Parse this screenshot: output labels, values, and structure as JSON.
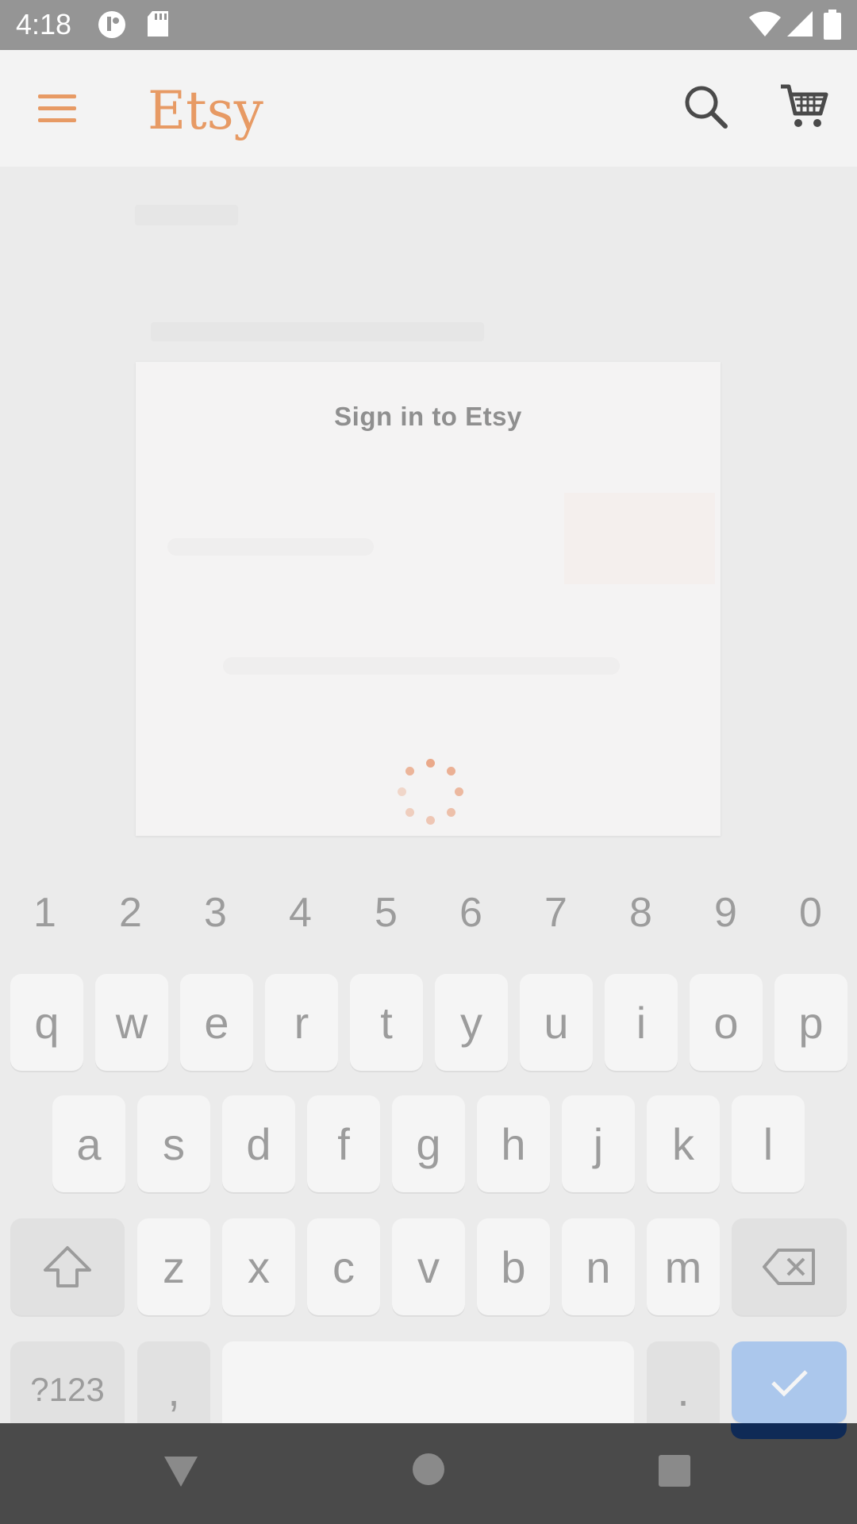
{
  "status_bar": {
    "time": "4:18"
  },
  "app_bar": {
    "logo": "Etsy"
  },
  "dialog": {
    "title": "Sign in to Etsy"
  },
  "keyboard": {
    "numbers": [
      "1",
      "2",
      "3",
      "4",
      "5",
      "6",
      "7",
      "8",
      "9",
      "0"
    ],
    "row1": [
      "q",
      "w",
      "e",
      "r",
      "t",
      "y",
      "u",
      "i",
      "o",
      "p"
    ],
    "row2": [
      "a",
      "s",
      "d",
      "f",
      "g",
      "h",
      "j",
      "k",
      "l"
    ],
    "row3": [
      "z",
      "x",
      "c",
      "v",
      "b",
      "n",
      "m"
    ],
    "symbols_label": "?123",
    "comma": ",",
    "period": "."
  },
  "colors": {
    "brand": "#e79a64",
    "enter": "#abc7ec",
    "statusbar": "#959595"
  }
}
